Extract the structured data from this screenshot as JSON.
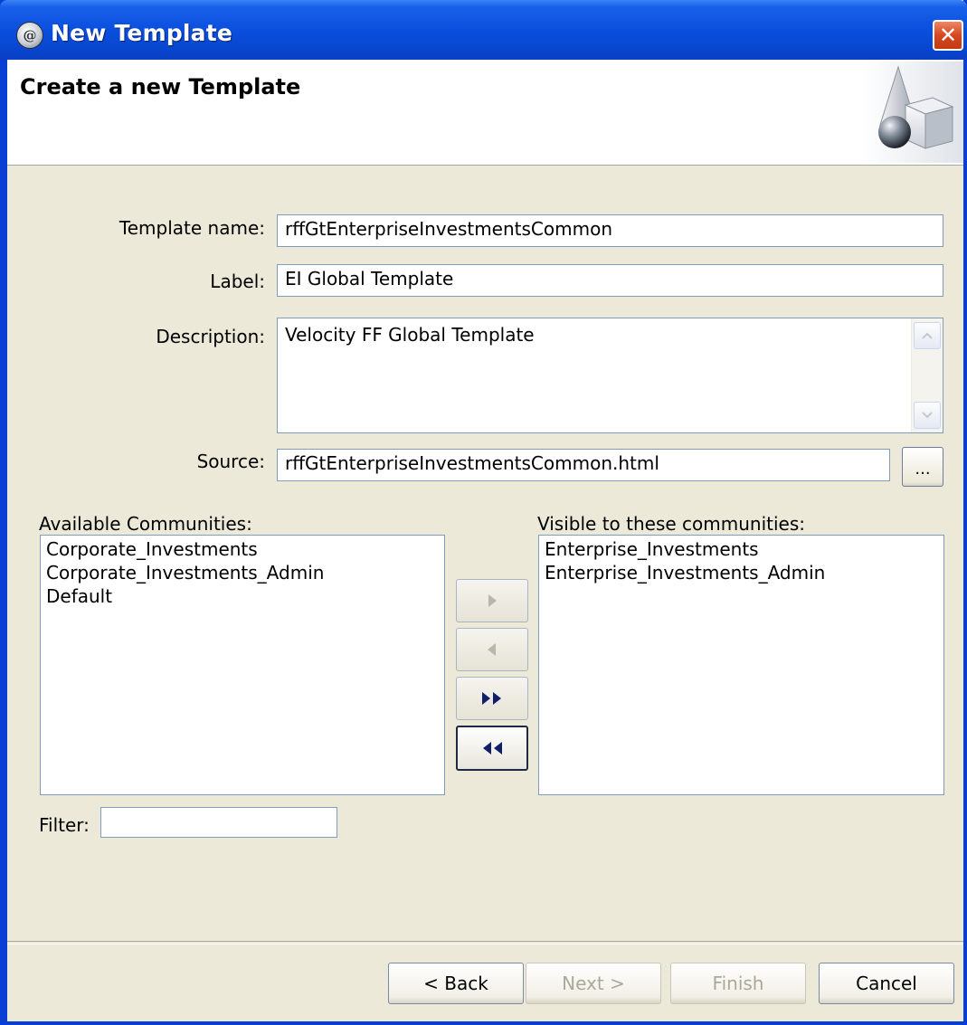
{
  "window": {
    "title": "New Template",
    "app_icon_letter": "@",
    "close_glyph": "✕"
  },
  "banner": {
    "title": "Create a new Template",
    "art_icon": "shapes-wizard-icon"
  },
  "form": {
    "template_name_label": "Template name:",
    "template_name_value": "rffGtEnterpriseInvestmentsCommon",
    "label_label": "Label:",
    "label_value": "EI Global Template",
    "description_label": "Description:",
    "description_value": "Velocity FF Global Template",
    "source_label": "Source:",
    "source_value": "rffGtEnterpriseInvestmentsCommon.html",
    "browse_label": "..."
  },
  "available": {
    "heading": "Available Communities:",
    "items": [
      "Corporate_Investments",
      "Corporate_Investments_Admin",
      "Default"
    ]
  },
  "visible": {
    "heading": "Visible to these communities:",
    "items": [
      "Enterprise_Investments",
      "Enterprise_Investments_Admin"
    ]
  },
  "filter": {
    "label": "Filter:",
    "value": ""
  },
  "footer": {
    "back_label": "< Back",
    "next_label": "Next >",
    "finish_label": "Finish",
    "cancel_label": "Cancel"
  },
  "colors": {
    "title_bar": "#0a4fde",
    "dialog_bg": "#ece9d8",
    "close_button": "#d8461e",
    "arrow_enabled": "#0f1f6b",
    "arrow_disabled": "#b9b6aa"
  }
}
